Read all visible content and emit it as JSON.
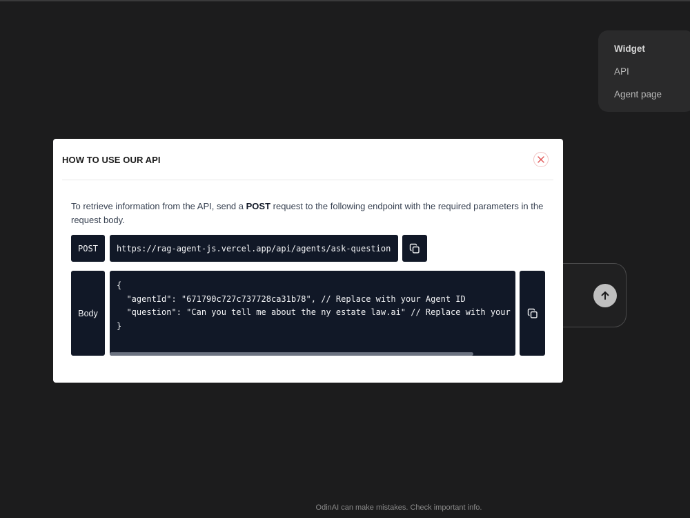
{
  "side_menu": {
    "items": [
      {
        "label": "Widget",
        "active": true
      },
      {
        "label": "API",
        "active": false
      },
      {
        "label": "Agent page",
        "active": false
      }
    ]
  },
  "modal": {
    "title": "HOW TO USE OUR API",
    "intro": {
      "before": "To retrieve information from the API, send a ",
      "method_bold": "POST",
      "after": " request to the following endpoint with the required parameters in the request body."
    },
    "endpoint": {
      "method_label": "POST",
      "url": "https://rag-agent-js.vercel.app/api/agents/ask-question"
    },
    "body": {
      "label": "Body",
      "lines": [
        "{",
        "  \"agentId\": \"671790c727c737728ca31b78\", // Replace with your Agent ID",
        "  \"question\": \"Can you tell me about the ny estate law.ai\" // Replace with your",
        "}"
      ]
    }
  },
  "footer": {
    "note": "OdinAI can make mistakes. Check important info."
  },
  "icons": {
    "close": "close-icon",
    "copy": "copy-icon",
    "send": "arrow-up-icon"
  },
  "colors": {
    "background": "#1c1c1d",
    "code_bg": "#111827",
    "close_red": "#e05252"
  }
}
